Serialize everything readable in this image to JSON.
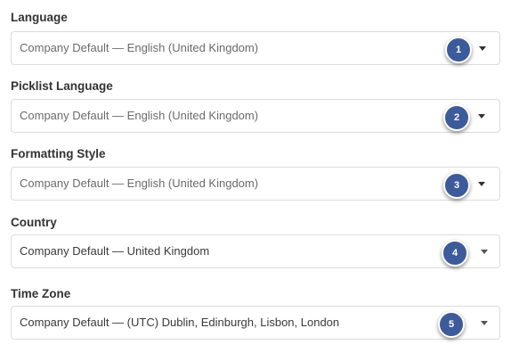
{
  "fields": [
    {
      "label": "Language",
      "value": "Company Default — English (United Kingdom)",
      "badge": "1",
      "icon": "chevron-down-icon"
    },
    {
      "label": "Picklist Language",
      "value": "Company Default — English (United Kingdom)",
      "badge": "2",
      "icon": "chevron-down-icon"
    },
    {
      "label": "Formatting Style",
      "value": "Company Default — English (United Kingdom)",
      "badge": "3",
      "icon": "chevron-down-icon"
    },
    {
      "label": "Country",
      "value": "Company Default — United Kingdom",
      "badge": "4",
      "icon": "chevron-down-icon"
    },
    {
      "label": "Time Zone",
      "value": "Company Default — (UTC) Dublin, Edinburgh, Lisbon, London",
      "badge": "5",
      "icon": "chevron-down-icon"
    }
  ],
  "colors": {
    "badge": "#3d5a9a",
    "border": "#dcdcdc",
    "label": "#333333"
  }
}
